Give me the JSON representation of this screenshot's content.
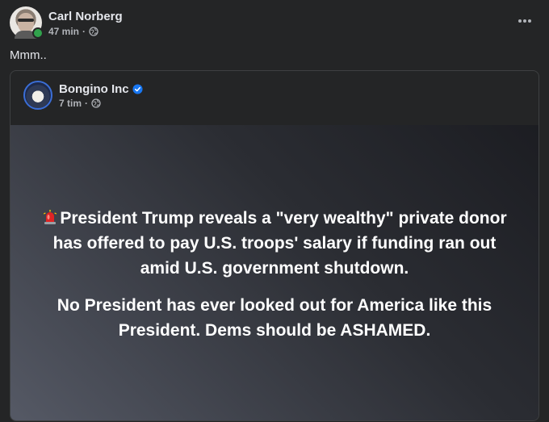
{
  "post": {
    "author": "Carl Norberg",
    "time": "47 min",
    "separator": "·",
    "text": "Mmm..",
    "more_label": "•••"
  },
  "shared": {
    "page_name": "Bongino Inc",
    "time": "7 tim",
    "separator": "·",
    "headline": "President Trump reveals a \"very wealthy\" private donor has offered to pay U.S. troops' salary if funding ran out amid U.S. government shutdown.",
    "subline": "No President has ever looked out for America like this President. Dems should be ASHAMED."
  },
  "colors": {
    "online": "#31a24c",
    "verified": "#1877f2",
    "siren": "#e02424"
  },
  "icons": {
    "privacy": "globe-icon",
    "verified": "verified-check-icon",
    "siren": "siren-icon",
    "more": "more-horizontal-icon"
  }
}
